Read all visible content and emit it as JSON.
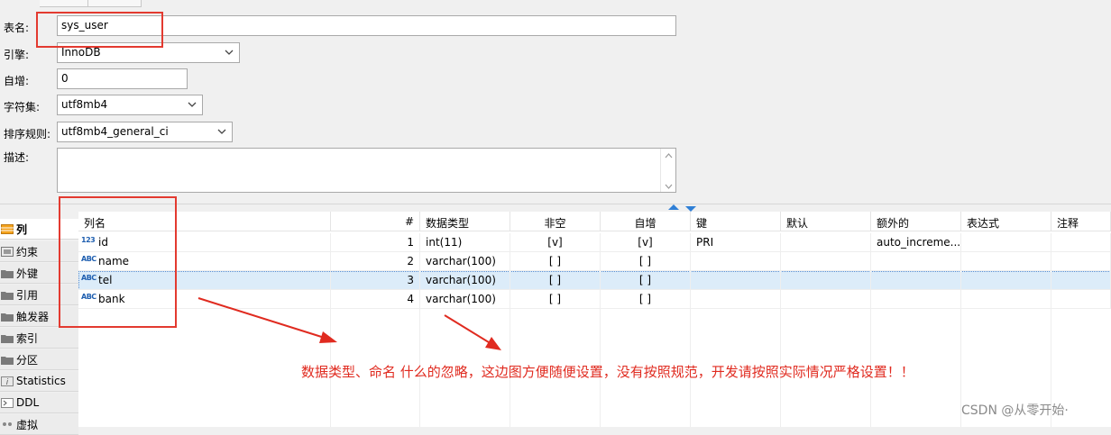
{
  "form": {
    "table_name": {
      "label": "表名:",
      "value": "sys_user"
    },
    "engine": {
      "label": "引擎:",
      "value": "InnoDB"
    },
    "auto_increment": {
      "label": "自增:",
      "value": "0"
    },
    "charset": {
      "label": "字符集:",
      "value": "utf8mb4"
    },
    "collation": {
      "label": "排序规则:",
      "value": "utf8mb4_general_ci"
    },
    "comment": {
      "label": "描述:",
      "value": ""
    }
  },
  "nav": {
    "items": [
      {
        "label": "列",
        "icon": "columns-icon",
        "active": true
      },
      {
        "label": "约束",
        "icon": "constraint-icon",
        "active": false
      },
      {
        "label": "外键",
        "icon": "folder-icon",
        "active": false
      },
      {
        "label": "引用",
        "icon": "folder-icon",
        "active": false
      },
      {
        "label": "触发器",
        "icon": "folder-icon",
        "active": false
      },
      {
        "label": "索引",
        "icon": "folder-icon",
        "active": false
      },
      {
        "label": "分区",
        "icon": "folder-icon",
        "active": false
      },
      {
        "label": "Statistics",
        "icon": "info-icon",
        "active": false
      },
      {
        "label": "DDL",
        "icon": "ddl-icon",
        "active": false
      },
      {
        "label": "虚拟",
        "icon": "virtual-icon",
        "active": false
      }
    ]
  },
  "grid": {
    "headers": {
      "name": "列名",
      "num": "#",
      "type": "数据类型",
      "notnull": "非空",
      "autoinc": "自增",
      "key": "键",
      "default": "默认",
      "extra": "额外的",
      "expr": "表达式",
      "comment": "注释"
    },
    "rows": [
      {
        "icon": "123",
        "name": "id",
        "num": "1",
        "type": "int(11)",
        "notnull": "[v]",
        "autoinc": "[v]",
        "key": "PRI",
        "default": "",
        "extra": "auto_increme...",
        "expr": "",
        "comment": ""
      },
      {
        "icon": "ABC",
        "name": "name",
        "num": "2",
        "type": "varchar(100)",
        "notnull": "[ ]",
        "autoinc": "[ ]",
        "key": "",
        "default": "",
        "extra": "",
        "expr": "",
        "comment": ""
      },
      {
        "icon": "ABC",
        "name": "tel",
        "num": "3",
        "type": "varchar(100)",
        "notnull": "[ ]",
        "autoinc": "[ ]",
        "key": "",
        "default": "",
        "extra": "",
        "expr": "",
        "comment": ""
      },
      {
        "icon": "ABC",
        "name": "bank",
        "num": "4",
        "type": "varchar(100)",
        "notnull": "[ ]",
        "autoinc": "[ ]",
        "key": "",
        "default": "",
        "extra": "",
        "expr": "",
        "comment": ""
      }
    ],
    "selected_row": 2
  },
  "annotation": {
    "text": "数据类型、命名 什么的忽略，这边图方便随便设置，没有按照规范，开发请按照实际情况严格设置！！",
    "color": "#e02b20"
  },
  "watermark": "CSDN @从零开始·"
}
